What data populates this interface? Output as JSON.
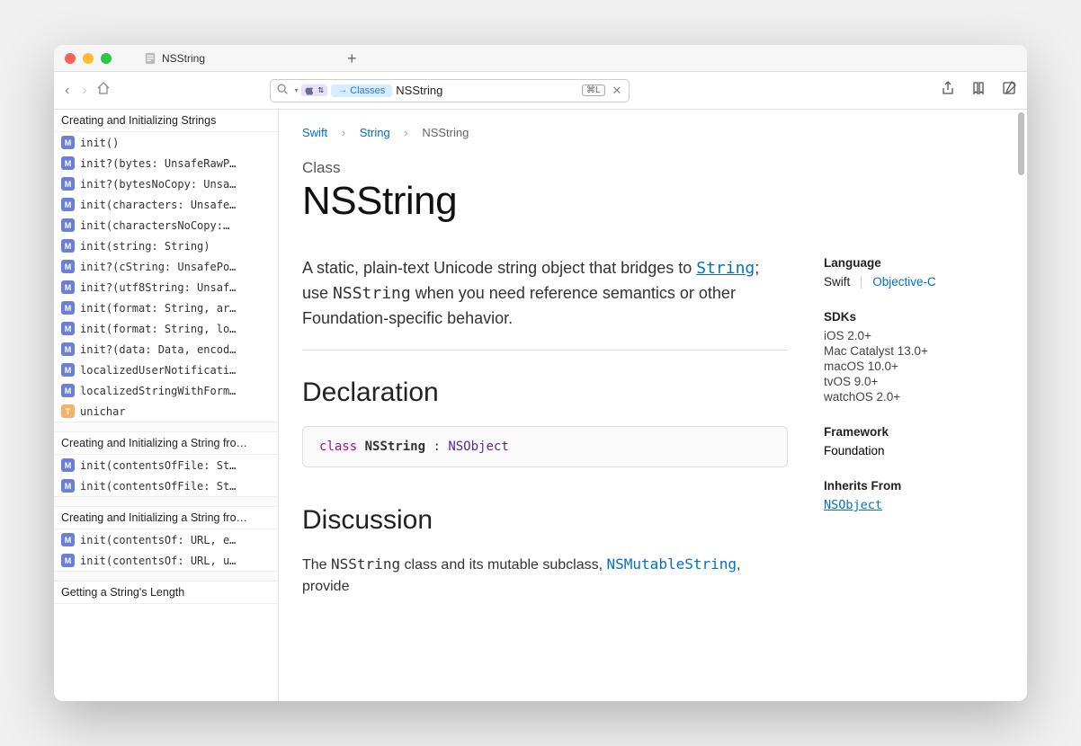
{
  "tab": {
    "title": "NSString",
    "addGlyph": "+"
  },
  "toolbar": {
    "searchValue": "NSString",
    "classesChip": "Classes",
    "kbdHint": "⌘L",
    "closeGlyph": "✕",
    "backGlyph": "‹",
    "fwdGlyph": "›"
  },
  "sidebar": {
    "sections": [
      {
        "title": "Creating and Initializing Strings",
        "items": [
          {
            "badge": "M",
            "label": "init()"
          },
          {
            "badge": "M",
            "label": "init?(bytes: UnsafeRawP…"
          },
          {
            "badge": "M",
            "label": "init?(bytesNoCopy: Unsa…"
          },
          {
            "badge": "M",
            "label": "init(characters: Unsafe…"
          },
          {
            "badge": "M",
            "label": "init(charactersNoCopy:…"
          },
          {
            "badge": "M",
            "label": "init(string: String)"
          },
          {
            "badge": "M",
            "label": "init?(cString: UnsafePo…"
          },
          {
            "badge": "M",
            "label": "init?(utf8String: Unsaf…"
          },
          {
            "badge": "M",
            "label": "init(format: String, ar…"
          },
          {
            "badge": "M",
            "label": "init(format: String, lo…"
          },
          {
            "badge": "M",
            "label": "init?(data: Data, encod…"
          },
          {
            "badge": "M",
            "label": "localizedUserNotificati…"
          },
          {
            "badge": "M",
            "label": "localizedStringWithForm…"
          },
          {
            "badge": "T",
            "label": "unichar"
          }
        ]
      },
      {
        "title": "Creating and Initializing a String fro…",
        "items": [
          {
            "badge": "M",
            "label": "init(contentsOfFile: St…"
          },
          {
            "badge": "M",
            "label": "init(contentsOfFile: St…"
          }
        ]
      },
      {
        "title": "Creating and Initializing a String fro…",
        "items": [
          {
            "badge": "M",
            "label": "init(contentsOf: URL, e…"
          },
          {
            "badge": "M",
            "label": "init(contentsOf: URL, u…"
          }
        ]
      },
      {
        "title": "Getting a String's Length",
        "items": []
      }
    ]
  },
  "breadcrumbs": {
    "items": [
      "Swift",
      "String",
      "NSString"
    ],
    "sep": "›"
  },
  "page": {
    "kind": "Class",
    "title": "NSString",
    "summaryParts": {
      "pre": "A static, plain-text Unicode string object that bridges to ",
      "link1": "String",
      "mid": "; use ",
      "code1": "NSString",
      "post": " when you need reference semantics or other Foundation-specific behavior."
    },
    "declHeading": "Declaration",
    "declaration": {
      "kw": "class",
      "name": "NSString",
      "colon": " : ",
      "super": "NSObject"
    },
    "discHeading": "Discussion",
    "discussion": {
      "pre": "The ",
      "c1": "NSString",
      "mid": " class and its mutable subclass, ",
      "link": "NSMutableString",
      "post": ", provide"
    }
  },
  "side": {
    "languageHeading": "Language",
    "langCurrent": "Swift",
    "langAlt": "Objective-C",
    "sdksHeading": "SDKs",
    "sdks": [
      "iOS 2.0+",
      "Mac Catalyst 13.0+",
      "macOS 10.0+",
      "tvOS 9.0+",
      "watchOS 2.0+"
    ],
    "frameworkHeading": "Framework",
    "frameworkValue": "Foundation",
    "inheritsHeading": "Inherits From",
    "inheritsValue": "NSObject"
  }
}
